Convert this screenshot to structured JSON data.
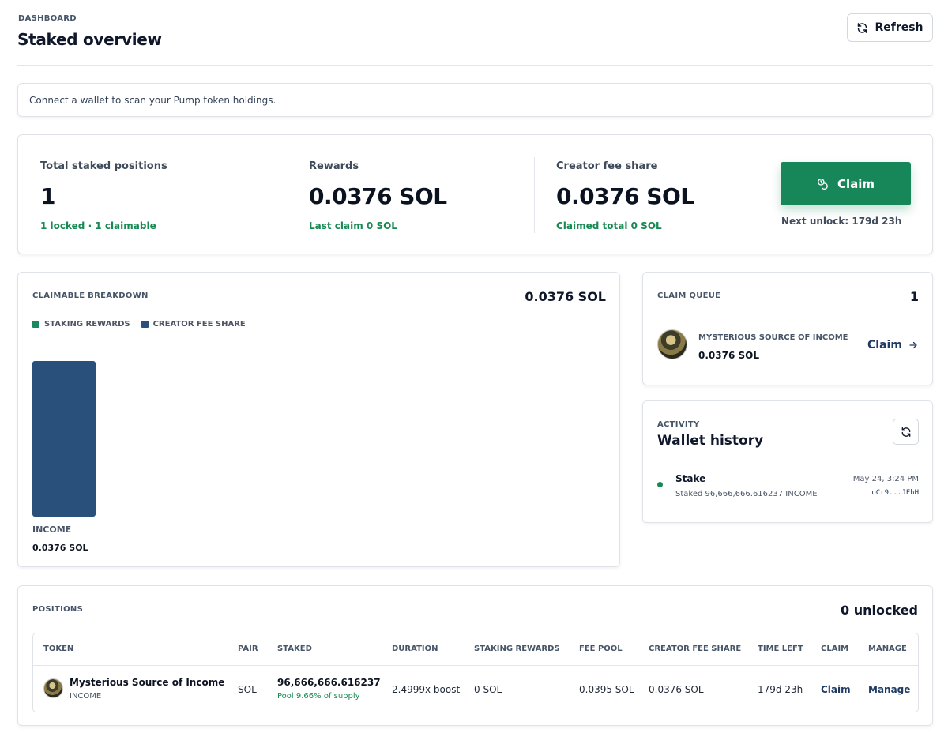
{
  "header": {
    "eyebrow": "DASHBOARD",
    "title": "Staked overview",
    "refresh_label": "Refresh"
  },
  "notice": "Connect a wallet to scan your Pump token holdings.",
  "stats": {
    "total_positions": {
      "label": "Total staked positions",
      "value": "1",
      "sub": "1 locked · 1 claimable"
    },
    "rewards": {
      "label": "Rewards",
      "value": "0.0376 SOL",
      "sub": "Last claim 0 SOL"
    },
    "creator_fee": {
      "label": "Creator fee share",
      "value": "0.0376 SOL",
      "sub": "Claimed total 0 SOL"
    },
    "claim_label": "Claim",
    "next_unlock": "Next unlock: 179d 23h"
  },
  "breakdown": {
    "eyebrow": "CLAIMABLE BREAKDOWN",
    "total": "0.0376 SOL",
    "legend": [
      {
        "label": "STAKING REWARDS",
        "color": "#178a5f"
      },
      {
        "label": "CREATOR FEE SHARE",
        "color": "#29507a"
      }
    ],
    "category_label": "INCOME",
    "category_value": "0.0376 SOL"
  },
  "chart_data": {
    "type": "bar",
    "categories": [
      "INCOME"
    ],
    "series": [
      {
        "name": "STAKING REWARDS",
        "values": [
          0
        ]
      },
      {
        "name": "CREATOR FEE SHARE",
        "values": [
          0.0376
        ]
      }
    ],
    "stacked": true,
    "ylim": [
      0,
      0.0376
    ],
    "grid": false,
    "legend": "top-left"
  },
  "queue": {
    "eyebrow": "CLAIM QUEUE",
    "count": "1",
    "item": {
      "name": "MYSTERIOUS SOURCE OF INCOME",
      "amount": "0.0376 SOL",
      "claim_label": "Claim"
    }
  },
  "activity": {
    "eyebrow": "ACTIVITY",
    "title": "Wallet history",
    "item": {
      "kind": "Stake",
      "detail": "Staked 96,666,666.616237 INCOME",
      "time": "May 24, 3:24 PM",
      "signature": "oCr9...JFhH"
    }
  },
  "positions": {
    "eyebrow": "POSITIONS",
    "unlocked": "0 unlocked",
    "columns": [
      "TOKEN",
      "PAIR",
      "STAKED",
      "DURATION",
      "STAKING REWARDS",
      "FEE POOL",
      "CREATOR FEE SHARE",
      "TIME LEFT",
      "CLAIM",
      "MANAGE"
    ],
    "rows": [
      {
        "token": "Mysterious Source of Income",
        "symbol": "INCOME",
        "pair": "SOL",
        "staked": "96,666,666.616237",
        "pool": "Pool 9.66% of supply",
        "duration": "2.4999x boost",
        "staking_rewards": "0 SOL",
        "fee_pool": "0.0395 SOL",
        "creator_fee_share": "0.0376 SOL",
        "time_left": "179d 23h",
        "claim": "Claim",
        "manage": "Manage"
      }
    ]
  },
  "colors": {
    "accent_green": "#17875a",
    "navy": "#29507a",
    "positive_text": "#178a53"
  }
}
